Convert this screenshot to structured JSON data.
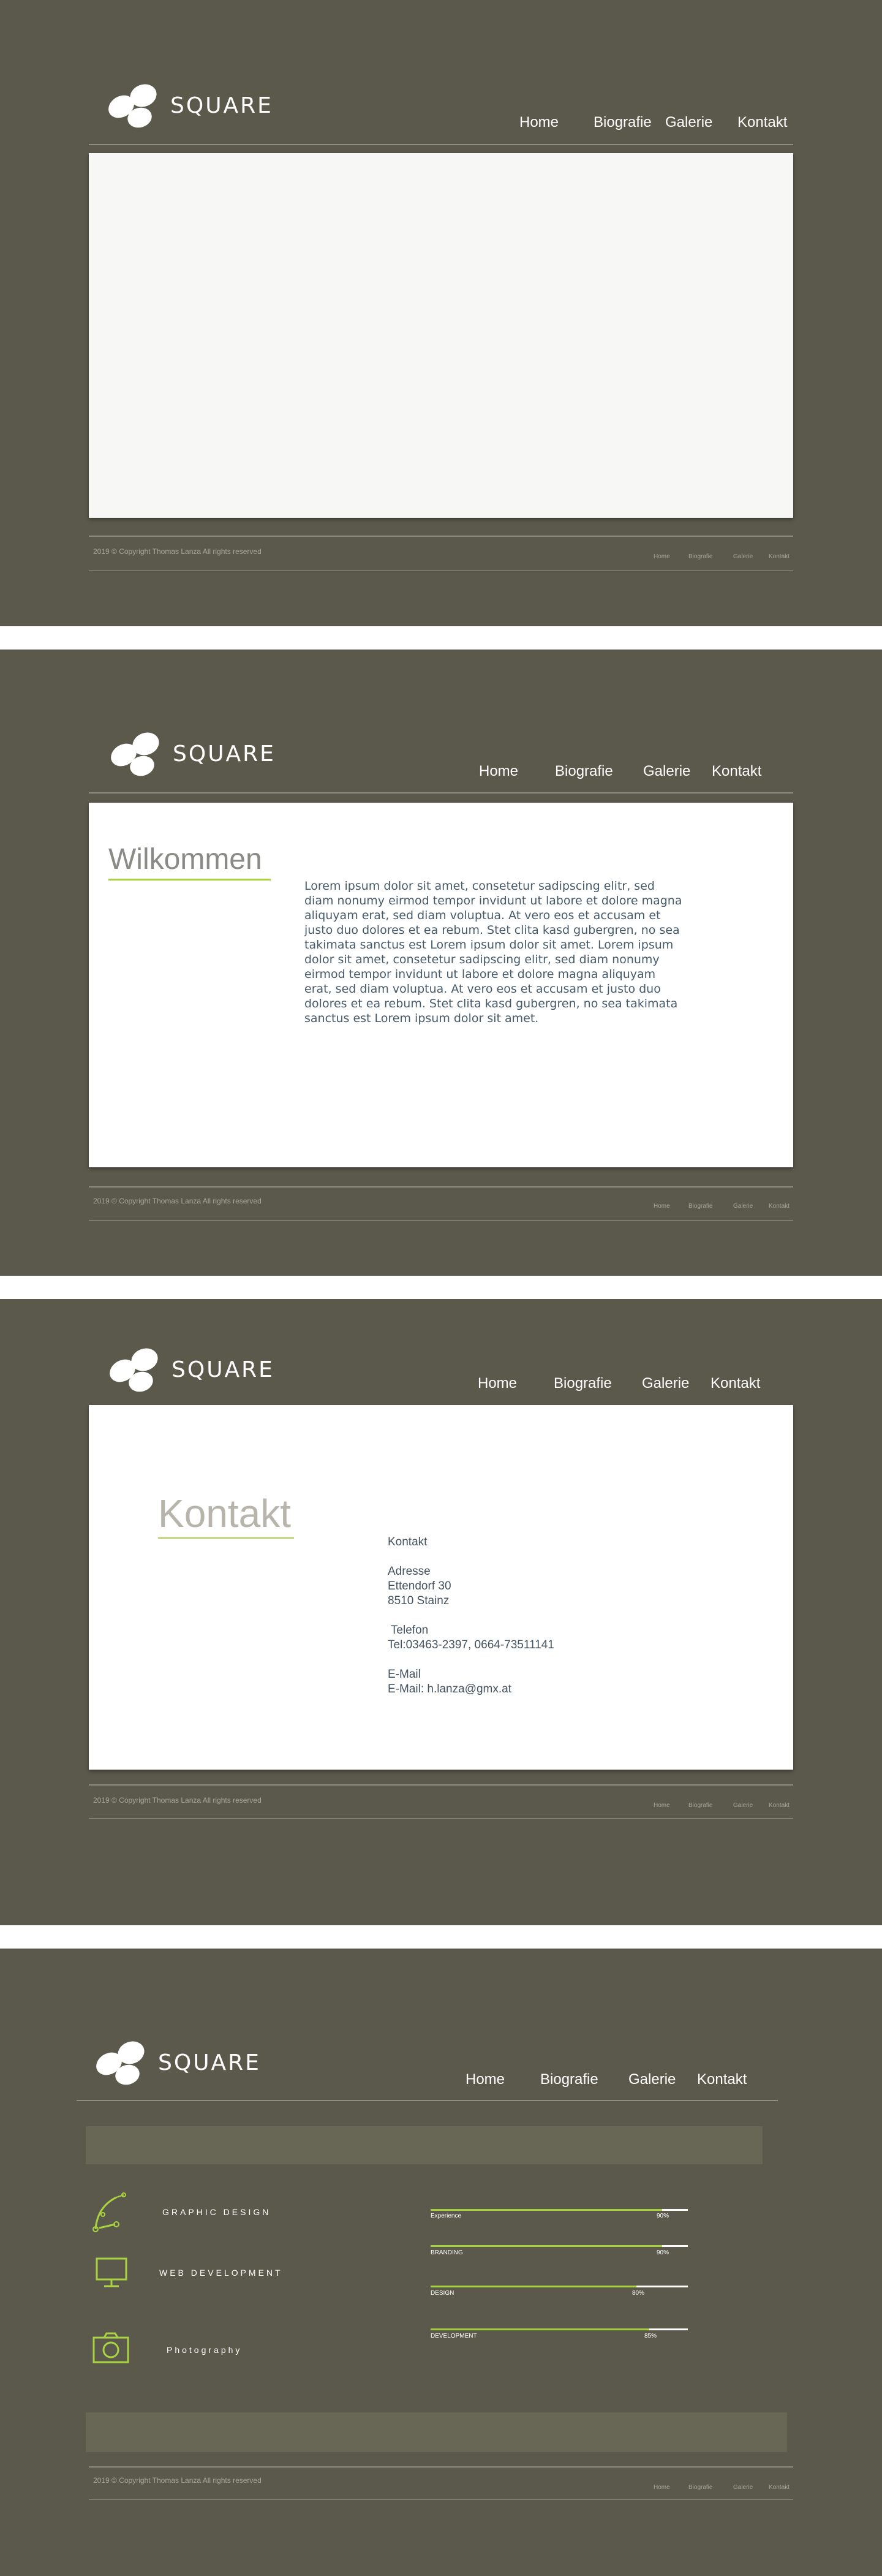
{
  "brand": {
    "name": "SQUARE"
  },
  "nav": [
    "Home",
    "Biografie",
    "Galerie",
    "Kontakt"
  ],
  "footer": {
    "copyright": "2019 © Copyright Thomas Lanza All rights reserved",
    "links": [
      "Home",
      "Biografie",
      "Galerie",
      "Kontakt"
    ]
  },
  "welcome": {
    "title": "Wilkommen",
    "body": "Lorem ipsum dolor sit amet, consetetur sadipscing elitr, sed diam nonumy eirmod tempor invidunt ut labore et dolore magna aliquyam erat, sed diam voluptua. At vero eos et accusam et justo duo dolores et ea rebum. Stet clita kasd gubergren, no sea takimata sanctus est Lorem ipsum dolor sit amet. Lorem ipsum dolor sit amet, consetetur sadipscing elitr, sed diam nonumy eirmod tempor invidunt ut labore et dolore magna aliquyam erat, sed diam voluptua. At vero eos et accusam et justo duo dolores et ea rebum. Stet clita kasd gubergren, no sea takimata sanctus est Lorem ipsum dolor sit amet."
  },
  "contact": {
    "title": "Kontakt",
    "heading": "Kontakt",
    "address_label": "Adresse",
    "street": "Ettendorf 30",
    "city": "8510 Stainz",
    "phone_label": " Telefon",
    "phone": "Tel:03463-2397, 0664-73511141",
    "email_label": "E-Mail",
    "email": "E-Mail: h.lanza@gmx.at"
  },
  "skills": {
    "services": [
      {
        "label": "GRAPHIC DESIGN",
        "icon": "pen-tool-icon"
      },
      {
        "label": "WEB DEVELOPMENT",
        "icon": "monitor-icon"
      },
      {
        "label": "Photography",
        "icon": "camera-icon"
      }
    ],
    "bars": [
      {
        "label": "Experience",
        "value": "90%",
        "fraction": 0.9
      },
      {
        "label": "BRANDING",
        "value": "90%",
        "fraction": 0.9
      },
      {
        "label": "DESIGN",
        "value": "80%",
        "fraction": 0.8
      },
      {
        "label": "DEVELOPMENT",
        "value": "85%",
        "fraction": 0.85
      }
    ]
  },
  "colors": {
    "background": "#5b594b",
    "accent": "#a9d340",
    "text_dark": "#465a6a"
  }
}
